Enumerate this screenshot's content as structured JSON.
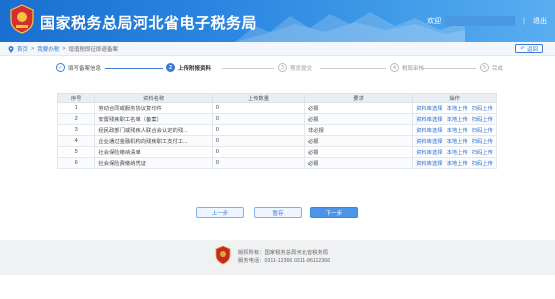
{
  "header": {
    "title": "国家税务总局河北省电子税务局",
    "welcome": "欢迎",
    "separator": "|",
    "logout": "退出"
  },
  "breadcrumb": {
    "home": "首页",
    "sep1": ">",
    "level2": "我要办税",
    "sep2": ">",
    "current": "增值税即征即退备案",
    "back": "返回"
  },
  "steps": [
    {
      "num": "1",
      "label": "填写备案信息",
      "state": "done"
    },
    {
      "num": "2",
      "label": "上传附报资料",
      "state": "active"
    },
    {
      "num": "3",
      "label": "预览提交",
      "state": "todo"
    },
    {
      "num": "4",
      "label": "税局审核",
      "state": "todo"
    },
    {
      "num": "5",
      "label": "完成",
      "state": "todo"
    }
  ],
  "table": {
    "headers": [
      "序号",
      "资料名称",
      "上传数量",
      "要求",
      "操作"
    ],
    "rows": [
      {
        "no": "1",
        "name": "劳动合同或服务协议复印件",
        "count": "0",
        "req": "必报"
      },
      {
        "no": "2",
        "name": "安置残疾职工名单（备案）",
        "count": "0",
        "req": "必报"
      },
      {
        "no": "3",
        "name": "经民政部门或残疾人联合会认定的残...",
        "count": "0",
        "req": "非必报"
      },
      {
        "no": "4",
        "name": "企业通过金融机构向残疾职工支付工...",
        "count": "0",
        "req": "必报"
      },
      {
        "no": "5",
        "name": "社会保险缴纳清单",
        "count": "0",
        "req": "必报"
      },
      {
        "no": "6",
        "name": "社会保险费缴纳凭证",
        "count": "0",
        "req": "必报"
      }
    ],
    "ops": [
      "资料库选择",
      "本地上传",
      "扫码上传"
    ]
  },
  "buttons": {
    "prev": "上一步",
    "save": "暂存",
    "next": "下一步"
  },
  "footer": {
    "line1": "版权所有：国家税务总局河北省税务局",
    "line2": "服务电话：0311-12366 0311-86112366"
  },
  "colors": {
    "brand": "#2a86e0",
    "accent": "#3a7bd5",
    "link": "#2a6dd0"
  }
}
